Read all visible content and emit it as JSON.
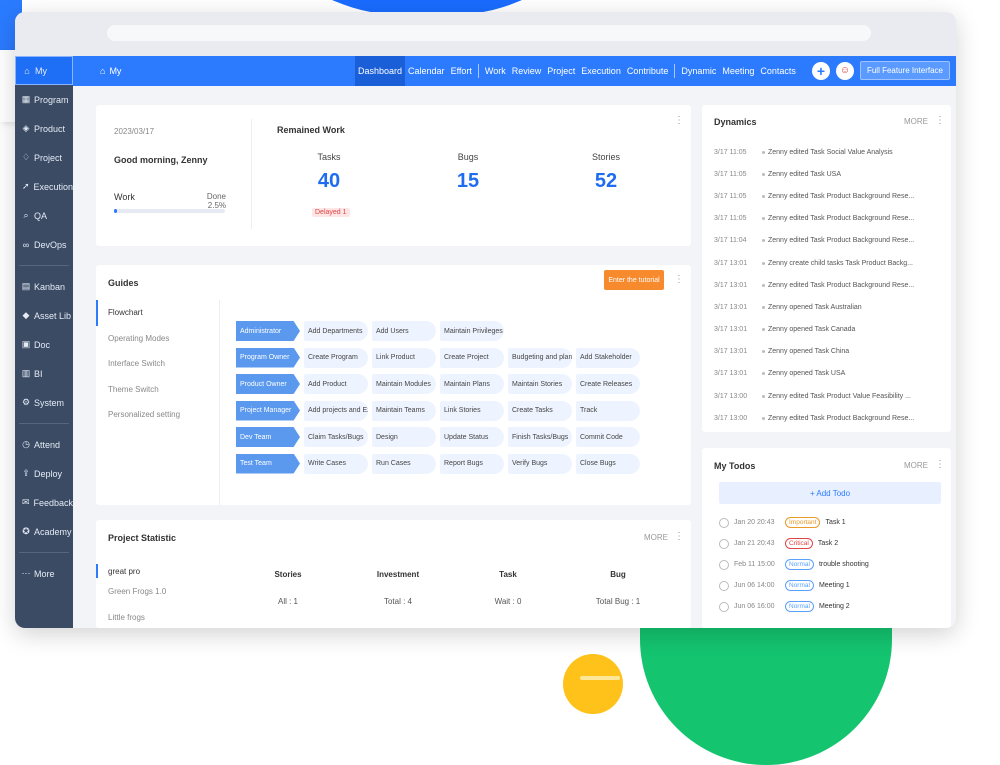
{
  "colors": {
    "accent": "#2c7bff",
    "sidebar": "#3b4b64",
    "orange": "#f68a2c",
    "critical": "#e04444",
    "important": "#e89b2a",
    "normal": "#5aa0ff"
  },
  "sidebar": {
    "items": [
      {
        "label": "My",
        "icon": "home-icon",
        "glyph": "⌂"
      },
      {
        "label": "Program",
        "icon": "grid-icon",
        "glyph": "▦"
      },
      {
        "label": "Product",
        "icon": "pin-icon",
        "glyph": "◈"
      },
      {
        "label": "Project",
        "icon": "drop-icon",
        "glyph": "♢"
      },
      {
        "label": "Execution",
        "icon": "rocket-icon",
        "glyph": "➚"
      },
      {
        "label": "QA",
        "icon": "search-icon",
        "glyph": "⌕"
      },
      {
        "label": "DevOps",
        "icon": "infinity-icon",
        "glyph": "∞"
      },
      {
        "label": "Kanban",
        "icon": "kanban-icon",
        "glyph": "▤"
      },
      {
        "label": "Asset Lib",
        "icon": "asset-icon",
        "glyph": "◆"
      },
      {
        "label": "Doc",
        "icon": "doc-icon",
        "glyph": "▣"
      },
      {
        "label": "BI",
        "icon": "chart-icon",
        "glyph": "▥"
      },
      {
        "label": "System",
        "icon": "system-icon",
        "glyph": "⚙"
      },
      {
        "label": "Attend",
        "icon": "attend-icon",
        "glyph": "◷"
      },
      {
        "label": "Deploy",
        "icon": "deploy-icon",
        "glyph": "⇪"
      },
      {
        "label": "Feedback",
        "icon": "feedback-icon",
        "glyph": "✉"
      },
      {
        "label": "Academy",
        "icon": "academy-icon",
        "glyph": "✪"
      },
      {
        "label": "More",
        "icon": "more-icon",
        "glyph": "⋯"
      }
    ]
  },
  "header": {
    "my": "My",
    "nav": [
      "Dashboard",
      "Calendar",
      "Effort",
      "Work",
      "Review",
      "Project",
      "Execution",
      "Contribute",
      "Dynamic",
      "Meeting",
      "Contacts"
    ],
    "full_feature": "Full Feature Interface"
  },
  "welcome": {
    "date": "2023/03/17",
    "greeting": "Good morning, Zenny",
    "work_label": "Work",
    "done_label": "Done 2.5%",
    "progress_pct": 2.5,
    "remained_title": "Remained Work",
    "stats": [
      {
        "label": "Tasks",
        "value": "40"
      },
      {
        "label": "Bugs",
        "value": "15"
      },
      {
        "label": "Stories",
        "value": "52"
      }
    ],
    "delayed": "Delayed 1"
  },
  "guides": {
    "title": "Guides",
    "tutorial_button": "Enter the tutorial",
    "menu": [
      "Flowchart",
      "Operating Modes",
      "Interface Switch",
      "Theme Switch",
      "Personalized setting"
    ],
    "rows": [
      {
        "role": "Administrator",
        "steps": [
          "Add Departments",
          "Add Users",
          "Maintain Privileges"
        ]
      },
      {
        "role": "Program Owner",
        "steps": [
          "Create Program",
          "Link Product",
          "Create Project",
          "Budgeting and planning",
          "Add Stakeholder"
        ]
      },
      {
        "role": "Product Owner",
        "steps": [
          "Add Product",
          "Maintain Modules",
          "Maintain Plans",
          "Maintain Stories",
          "Create Releases"
        ]
      },
      {
        "role": "Project Manager",
        "steps": [
          "Add projects and Execution",
          "Maintain Teams",
          "Link Stories",
          "Create Tasks",
          "Track"
        ]
      },
      {
        "role": "Dev Team",
        "steps": [
          "Claim Tasks/Bugs",
          "Design",
          "Update Status",
          "Finish Tasks/Bugs",
          "Commit Code"
        ]
      },
      {
        "role": "Test Team",
        "steps": [
          "Write Cases",
          "Run Cases",
          "Report Bugs",
          "Verify Bugs",
          "Close Bugs"
        ]
      }
    ]
  },
  "project_statistic": {
    "title": "Project Statistic",
    "more": "MORE",
    "projects": [
      "great pro",
      "Green Frogs 1.0",
      "Little frogs"
    ],
    "columns": [
      {
        "header": "Stories",
        "value": "All : 1"
      },
      {
        "header": "Investment",
        "value": "Total : 4"
      },
      {
        "header": "Task",
        "value": "Wait : 0"
      },
      {
        "header": "Bug",
        "value": "Total Bug : 1"
      }
    ]
  },
  "dynamics": {
    "title": "Dynamics",
    "more": "MORE",
    "items": [
      {
        "time": "3/17 11:05",
        "text": "Zenny edited  Task Social Value Analysis"
      },
      {
        "time": "3/17 11:05",
        "text": "Zenny edited  Task USA"
      },
      {
        "time": "3/17 11:05",
        "text": "Zenny edited  Task Product Background Rese..."
      },
      {
        "time": "3/17 11:05",
        "text": "Zenny edited  Task Product Background Rese..."
      },
      {
        "time": "3/17 11:04",
        "text": "Zenny edited  Task Product Background Rese..."
      },
      {
        "time": "3/17 13:01",
        "text": "Zenny create child tasks  Task Product Backg..."
      },
      {
        "time": "3/17 13:01",
        "text": "Zenny edited  Task Product Background Rese..."
      },
      {
        "time": "3/17 13:01",
        "text": "Zenny opened  Task Australian"
      },
      {
        "time": "3/17 13:01",
        "text": "Zenny opened  Task Canada"
      },
      {
        "time": "3/17 13:01",
        "text": "Zenny opened  Task China"
      },
      {
        "time": "3/17 13:01",
        "text": "Zenny opened  Task USA"
      },
      {
        "time": "3/17 13:00",
        "text": "Zenny edited  Task Product Value Feasibility ..."
      },
      {
        "time": "3/17 13:00",
        "text": "Zenny edited  Task Product Background Rese..."
      }
    ]
  },
  "todos": {
    "title": "My Todos",
    "more": "MORE",
    "add_label": "+ Add Todo",
    "items": [
      {
        "date": "Jan 20 20:43",
        "tag": "Important",
        "level": "important",
        "text": "Task 1"
      },
      {
        "date": "Jan 21 20:43",
        "tag": "Critical",
        "level": "critical",
        "text": "Task 2"
      },
      {
        "date": "Feb 11 15:00",
        "tag": "Normal",
        "level": "normal",
        "text": "trouble shooting"
      },
      {
        "date": "Jun 06 14:00",
        "tag": "Normal",
        "level": "normal",
        "text": "Meeting 1"
      },
      {
        "date": "Jun 06 16:00",
        "tag": "Normal",
        "level": "normal",
        "text": "Meeting 2"
      }
    ]
  }
}
